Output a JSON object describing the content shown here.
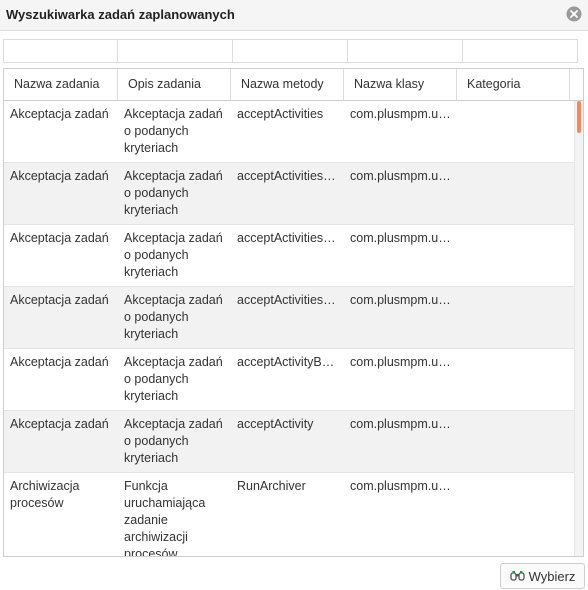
{
  "dialog": {
    "title": "Wyszukiwarka zadań zaplanowanych"
  },
  "filters": [
    {
      "value": "",
      "placeholder": ""
    },
    {
      "value": "",
      "placeholder": ""
    },
    {
      "value": "",
      "placeholder": ""
    },
    {
      "value": "",
      "placeholder": ""
    },
    {
      "value": "",
      "placeholder": ""
    }
  ],
  "grid": {
    "columns": [
      "Nazwa zadania",
      "Opis zadania",
      "Nazwa metody",
      "Nazwa klasy",
      "Kategoria"
    ],
    "rows": [
      {
        "name": "Akceptacja zadań",
        "description": "Akceptacja zadań o podanych kryteriach",
        "method": "acceptActivities",
        "class": "com.plusmpm.util.scheduledTasks.ScheduledTasks",
        "category": ""
      },
      {
        "name": "Akceptacja zadań",
        "description": "Akceptacja zadań o podanych kryteriach",
        "method": "acceptActivitiesByProcessDefinition",
        "class": "com.plusmpm.util.scheduledTasks.ScheduledTasks",
        "category": ""
      },
      {
        "name": "Akceptacja zadań",
        "description": "Akceptacja zadań o podanych kryteriach",
        "method": "acceptActivitiesByActivityDefinition",
        "class": "com.plusmpm.util.scheduledTasks.ScheduledTasks",
        "category": ""
      },
      {
        "name": "Akceptacja zadań",
        "description": "Akceptacja zadań o podanych kryteriach",
        "method": "acceptActivitiesWithVariables",
        "class": "com.plusmpm.util.scheduledTasks.ScheduledTasks",
        "category": ""
      },
      {
        "name": "Akceptacja zadań",
        "description": "Akceptacja zadań o podanych kryteriach",
        "method": "acceptActivityByName",
        "class": "com.plusmpm.util.scheduledTasks.ScheduledTasks",
        "category": ""
      },
      {
        "name": "Akceptacja zadań",
        "description": "Akceptacja zadań o podanych kryteriach",
        "method": "acceptActivity",
        "class": "com.plusmpm.util.scheduledTasks.ScheduledTasks",
        "category": ""
      },
      {
        "name": "Archiwizacja procesów",
        "description": "Funkcja uruchamiająca zadanie archiwizacji procesów, sprawdza",
        "method": "RunArchiver",
        "class": "com.plusmpm.util.scheduledTasks.ScheduledTasks",
        "category": ""
      }
    ]
  },
  "footer": {
    "select_label": "Wybierz",
    "select_icon": "select-binoculars-icon"
  },
  "colors": {
    "scroll_thumb": "#f08a5d",
    "alt_row": "#f2f2f2"
  }
}
